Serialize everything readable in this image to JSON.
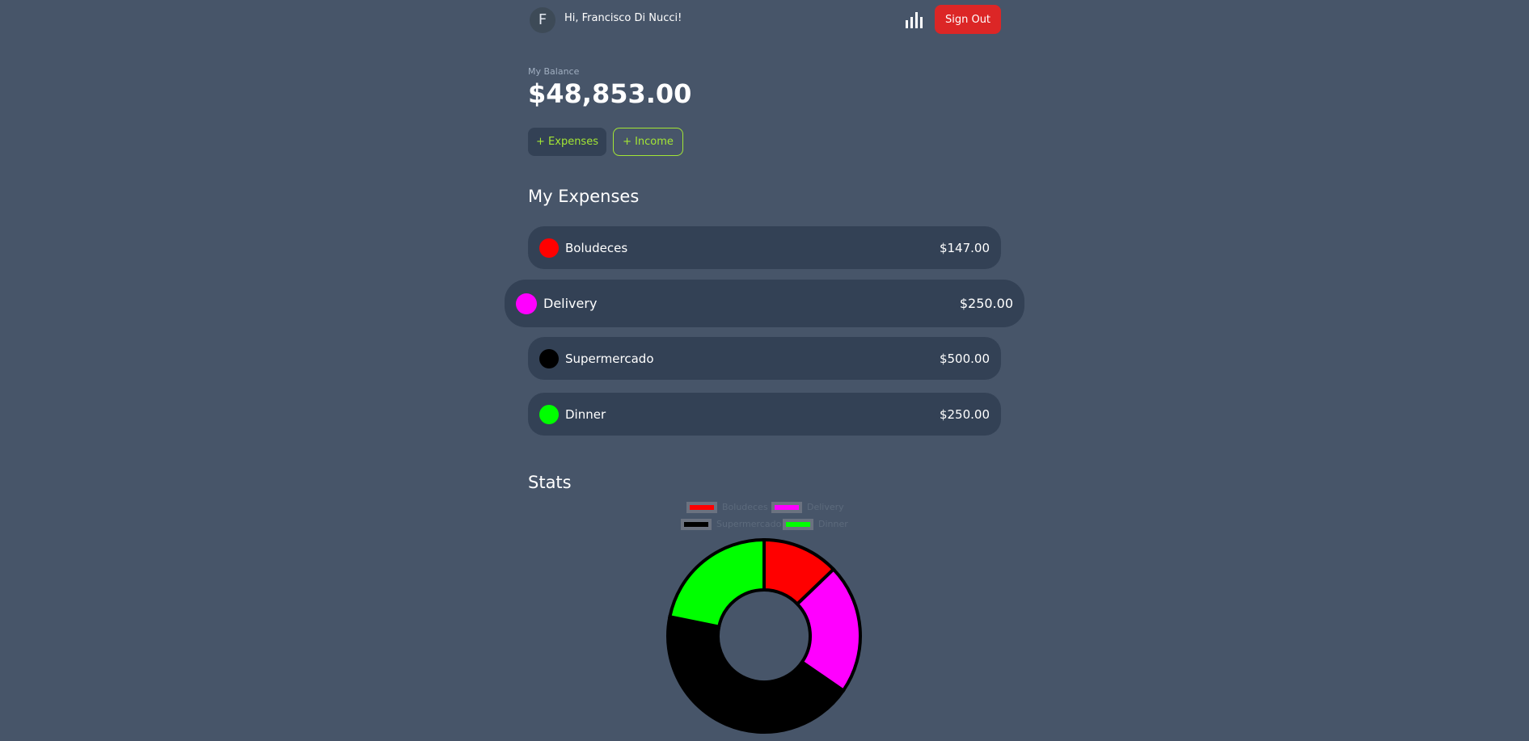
{
  "header": {
    "avatar_letter": "F",
    "greeting": "Hi, Francisco Di Nucci!",
    "stats_icon": "bar-chart-icon",
    "sign_out_label": "Sign Out"
  },
  "balance": {
    "label": "My Balance",
    "value": "$48,853.00"
  },
  "actions": {
    "expenses_label": "+ Expenses",
    "income_label": "+ Income"
  },
  "expenses": {
    "title": "My Expenses",
    "items": [
      {
        "name": "Boludeces",
        "amount": "$147.00",
        "color": "#ff0000"
      },
      {
        "name": "Delivery",
        "amount": "$250.00",
        "color": "#ff00ff"
      },
      {
        "name": "Supermercado",
        "amount": "$500.00",
        "color": "#000000"
      },
      {
        "name": "Dinner",
        "amount": "$250.00",
        "color": "#00ff00"
      }
    ]
  },
  "stats": {
    "title": "Stats"
  },
  "colors": {
    "background": "#475569",
    "card": "#334155",
    "accent": "#a3e635",
    "danger": "#dc2626"
  },
  "chart_data": {
    "type": "pie",
    "variant": "doughnut",
    "categories": [
      "Boludeces",
      "Delivery",
      "Supermercado",
      "Dinner"
    ],
    "values": [
      147,
      250,
      500,
      250
    ],
    "colors": [
      "#ff0000",
      "#ff00ff",
      "#000000",
      "#00ff00"
    ],
    "legend": "top"
  }
}
